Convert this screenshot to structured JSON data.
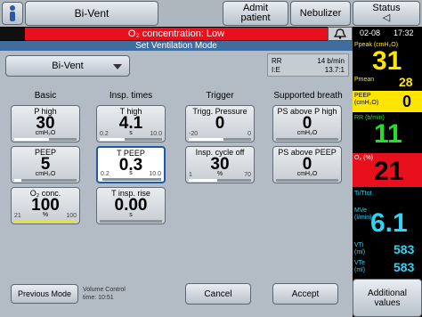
{
  "topbar": {
    "mode_tab": "Bi-Vent",
    "admit_label": "Admit\npatient",
    "admit_line1": "Admit",
    "admit_line2": "patient",
    "nebulizer_label": "Nebulizer",
    "status_line1": "Status",
    "status_line2": "◁",
    "person_icon": "person-icon"
  },
  "alarm": {
    "text": "O₂ concentration: Low",
    "bell_icon": "bell-icon",
    "color": "#e8101c"
  },
  "panel": {
    "title": "Set Ventilation Mode",
    "mode_value": "Bi-Vent",
    "rr_label": "RR",
    "rr_value": "14 b/min",
    "ie_label": "I:E",
    "ie_value": "13.7:1"
  },
  "columns": {
    "basic": "Basic",
    "insp_times": "Insp. times",
    "trigger": "Trigger",
    "supported": "Supported breath"
  },
  "params": {
    "p_high": {
      "label": "P high",
      "value": "30",
      "unit": "cmH₂O",
      "level": 0.55
    },
    "peep": {
      "label": "PEEP",
      "value": "5",
      "unit": "cmH₂O",
      "level": 0.12
    },
    "o2": {
      "label": "O₂ conc.",
      "value": "100",
      "unit": "%",
      "min": "21",
      "max": "100",
      "level": 1.0
    },
    "t_high": {
      "label": "T high",
      "value": "4.1",
      "unit": "s",
      "min": "0.2",
      "max": "10.0",
      "level": 0.4
    },
    "t_peep": {
      "label": "T PEEP",
      "value": "0.3",
      "unit": "s",
      "min": "0.2",
      "max": "10.0",
      "level": 0.03
    },
    "t_insp_rise": {
      "label": "T insp. rise",
      "value": "0.00",
      "unit": "s",
      "level": 0.0
    },
    "trigg_pressure": {
      "label": "Trigg. Pressure",
      "value": "0",
      "unit": "",
      "min": "-20",
      "max": "0",
      "level": 0.55
    },
    "insp_cycle_off": {
      "label": "Insp. cycle off",
      "value": "30",
      "unit": "%",
      "min": "1",
      "max": "70",
      "level": 0.45
    },
    "ps_above_phigh": {
      "label": "PS above P high",
      "value": "0",
      "unit": "cmH₂O",
      "level": 0.0
    },
    "ps_above_peep": {
      "label": "PS above PEEP",
      "value": "0",
      "unit": "cmH₂O",
      "level": 0.0
    }
  },
  "footer": {
    "previous_mode": "Previous Mode",
    "vc_line1": "Volume Control",
    "vc_line2": "time: 10:51",
    "cancel": "Cancel",
    "accept": "Accept",
    "additional_values_line1": "Additional",
    "additional_values_line2": "values"
  },
  "monitor": {
    "date": "02-08",
    "time": "17:32",
    "ppeak_label": "Ppeak",
    "ppeak_unit": "(cmH₂O)",
    "ppeak_value": "31",
    "pmean_label": "Pmean",
    "pmean_value": "28",
    "peep_label": "PEEP",
    "peep_unit": "(cmH₂O)",
    "peep_value": "0",
    "rr_label": "RR",
    "rr_unit": "(b/min)",
    "rr_value": "11",
    "o2_label": "O₂",
    "o2_unit": "(%)",
    "o2_value": "21",
    "titot_label": "Ti/Ttot",
    "mve_label": "MVe",
    "mve_unit": "(l/min)",
    "mve_value": "6.1",
    "vti_label": "VTi",
    "vti_unit": "(ml)",
    "vti_value": "583",
    "vte_label": "VTe",
    "vte_unit": "(ml)",
    "vte_value": "583",
    "colors": {
      "yellow": "#ffe600",
      "green": "#22e02a",
      "cyan": "#2fd3f5",
      "red": "#e8101c"
    }
  }
}
